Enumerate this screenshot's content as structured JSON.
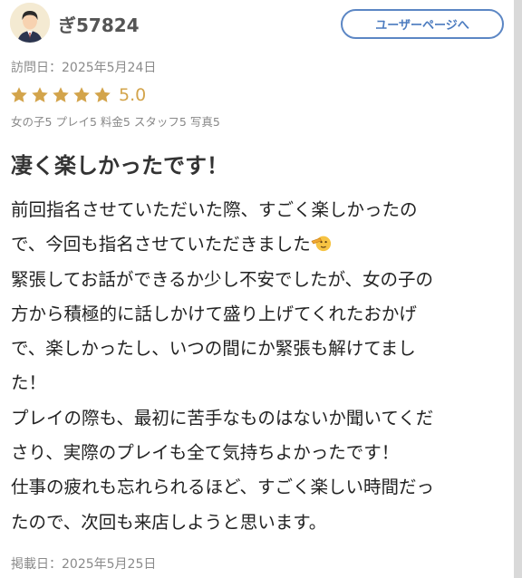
{
  "user": {
    "name": "ぎ57824",
    "button_label": "ユーザーページへ"
  },
  "visit_date": "訪問日：2025年5月24日",
  "rating": {
    "value": "5.0",
    "stars": 5
  },
  "sub_ratings": [
    "女の子5",
    "プレイ5",
    "料金5",
    "スタッフ5",
    "写真5"
  ],
  "review": {
    "title": "凄く楽しかったです！",
    "lines": [
      "前回指名させていただいた際、すごく楽しかったの",
      "で、今回も指名させていただきました",
      "緊張してお話ができるか少し不安でしたが、女の子の",
      "方から積極的に話しかけて盛り上げてくれたおかげ",
      "で、楽しかったし、いつの間にか緊張も解けてまし",
      "た！",
      "プレイの際も、最初に苦手なものはないか聞いてくだ",
      "さり、実際のプレイも全て気持ちよかったです！",
      "仕事の疲れも忘れられるほど、すごく楽しい時間だっ",
      "たので、次回も来店しようと思います。"
    ],
    "emoji_icon": "saluting-face-emoji"
  },
  "posted_date": "掲載日：2025年5月25日",
  "colors": {
    "accent": "#5b86c4",
    "star": "#d3a44b"
  }
}
